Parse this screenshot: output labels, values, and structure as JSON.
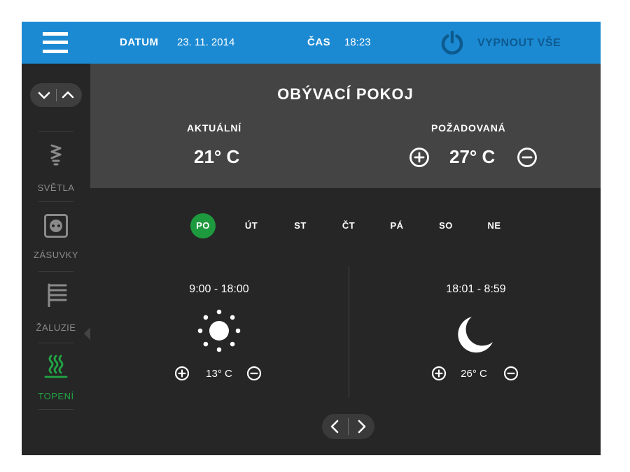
{
  "header": {
    "date_label": "DATUM",
    "date_value": "23. 11. 2014",
    "time_label": "ČAS",
    "time_value": "18:23",
    "power_off_label": "VYPNOUT VŠE",
    "menu_icon": "hamburger-menu-icon",
    "power_icon": "power-icon"
  },
  "sidebar": {
    "items": [
      {
        "label": "SVĚTLA",
        "icon": "light-bulb-icon",
        "active": false
      },
      {
        "label": "ZÁSUVKY",
        "icon": "socket-icon",
        "active": false
      },
      {
        "label": "ŽALUZIE",
        "icon": "blinds-icon",
        "active": false
      },
      {
        "label": "TOPENÍ",
        "icon": "heating-icon",
        "active": true
      }
    ]
  },
  "room": {
    "title": "OBÝVACÍ POKOJ",
    "current_label": "AKTUÁLNÍ",
    "current_temp": "21° C",
    "target_label": "POŽADOVANÁ",
    "target_temp": "27° C"
  },
  "schedule": {
    "days": [
      "PO",
      "ÚT",
      "ST",
      "ČT",
      "PÁ",
      "SO",
      "NE"
    ],
    "active_day": "PO",
    "day_slot": {
      "range": "9:00 - 18:00",
      "temp": "13° C",
      "icon": "sun-icon"
    },
    "night_slot": {
      "range": "18:01 - 8:59",
      "temp": "26° C",
      "icon": "moon-icon"
    }
  },
  "colors": {
    "header_bg": "#1c8ad3",
    "accent_green": "#1e9a3e",
    "power_blue": "#0c5a8f",
    "panel_bg": "#444444",
    "app_bg": "#262626"
  }
}
